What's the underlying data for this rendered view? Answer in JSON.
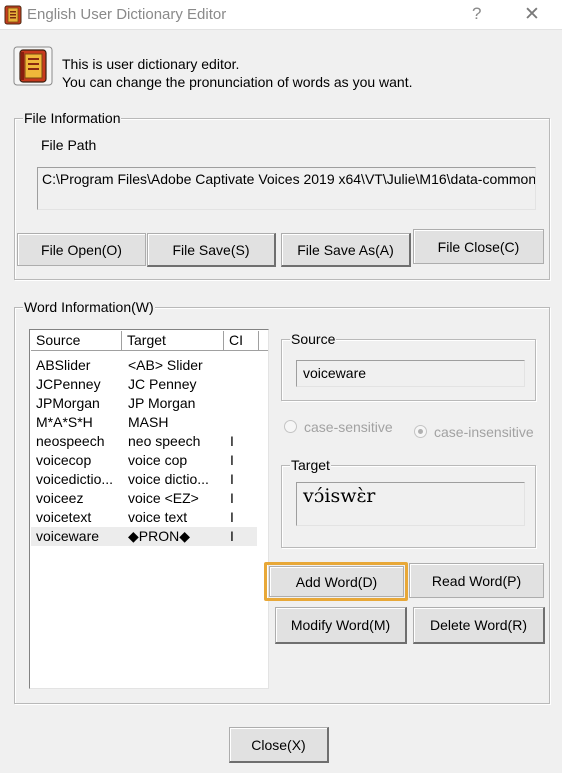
{
  "window": {
    "title": "English User Dictionary Editor",
    "help_label": "?",
    "close_label": "✕"
  },
  "intro": {
    "line1": "This is user dictionary editor.",
    "line2": "You can change the pronunciation of words as you want."
  },
  "file_info": {
    "group_label": "File Information",
    "path_label": "File Path",
    "path_value": "C:\\Program Files\\Adobe Captivate Voices 2019 x64\\VT\\Julie\\M16\\data-common\\userdict\\userdict_eng.csv",
    "buttons": {
      "open": "File Open(O)",
      "save": "File Save(S)",
      "save_as": "File Save As(A)",
      "close": "File Close(C)"
    }
  },
  "word_info": {
    "group_label": "Word Information(W)",
    "columns": {
      "source": "Source",
      "target": "Target",
      "ci": "CI"
    },
    "rows": [
      {
        "source": "ABSlider",
        "target": "<AB> Slider",
        "ci": ""
      },
      {
        "source": "JCPenney",
        "target": "JC Penney",
        "ci": ""
      },
      {
        "source": "JPMorgan",
        "target": "JP Morgan",
        "ci": ""
      },
      {
        "source": "M*A*S*H",
        "target": "MASH",
        "ci": ""
      },
      {
        "source": "neospeech",
        "target": "neo speech",
        "ci": "I"
      },
      {
        "source": "voicecop",
        "target": "voice cop",
        "ci": "I"
      },
      {
        "source": "voicedictio...",
        "target": "voice dictio...",
        "ci": "I"
      },
      {
        "source": "voiceez",
        "target": "voice <EZ>",
        "ci": "I"
      },
      {
        "source": "voicetext",
        "target": "voice text",
        "ci": "I"
      },
      {
        "source": "voiceware",
        "target": "◆PRON◆",
        "ci": "I"
      }
    ],
    "source_group_label": "Source",
    "source_value": "voiceware",
    "radio_case_sensitive": "case-sensitive",
    "radio_case_insensitive": "case-insensitive",
    "selected_case": "case-insensitive",
    "target_group_label": "Target",
    "target_value": "vɔ́iswɛ̀r",
    "buttons": {
      "add": "Add Word(D)",
      "read": "Read Word(P)",
      "modify": "Modify Word(M)",
      "delete": "Delete Word(R)"
    },
    "highlight_color": "#e8a838"
  },
  "footer": {
    "close_button": "Close(X)"
  }
}
